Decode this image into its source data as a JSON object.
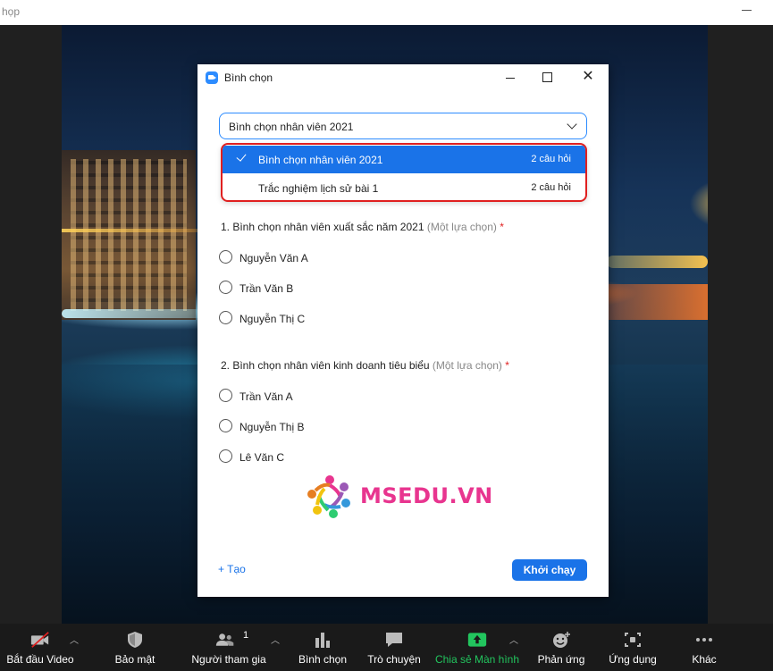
{
  "window": {
    "title": "họp"
  },
  "dialog": {
    "title": "Bình chọn",
    "select_value": "Bình chọn nhân viên 2021",
    "options": [
      {
        "label": "Bình chọn nhân viên 2021",
        "count": "2 câu hỏi",
        "selected": true
      },
      {
        "label": "Trắc nghiệm lịch sử bài 1",
        "count": "2 câu hỏi",
        "selected": false
      }
    ],
    "questions": [
      {
        "text": "1. Bình chọn nhân viên xuất sắc năm 2021",
        "hint": "(Một lựa chọn)",
        "required": "*",
        "answers": [
          "Nguyễn Văn A",
          "Trần Văn B",
          "Nguyễn Thị C"
        ]
      },
      {
        "text": "2. Bình chọn nhân viên kinh doanh tiêu biểu",
        "hint": "(Một lựa chọn)",
        "required": "*",
        "answers": [
          "Trần Văn A",
          "Nguyễn Thị B",
          "Lê Văn C"
        ]
      }
    ],
    "logo_text": "MSEDU.VN",
    "create_label": "+ Tạo",
    "launch_label": "Khởi chạy"
  },
  "toolbar": {
    "video": "Bắt đầu Video",
    "security": "Bảo mật",
    "participants": "Người tham gia",
    "participants_count": "1",
    "polls": "Bình chọn",
    "chat": "Trò chuyện",
    "share": "Chia sẻ Màn hình",
    "reactions": "Phản ứng",
    "apps": "Ứng dụng",
    "more": "Khác"
  },
  "colors": {
    "accent": "#1a73e8",
    "highlight_border": "#e02020",
    "share_green": "#22c55e",
    "logo": "#e8358f"
  }
}
